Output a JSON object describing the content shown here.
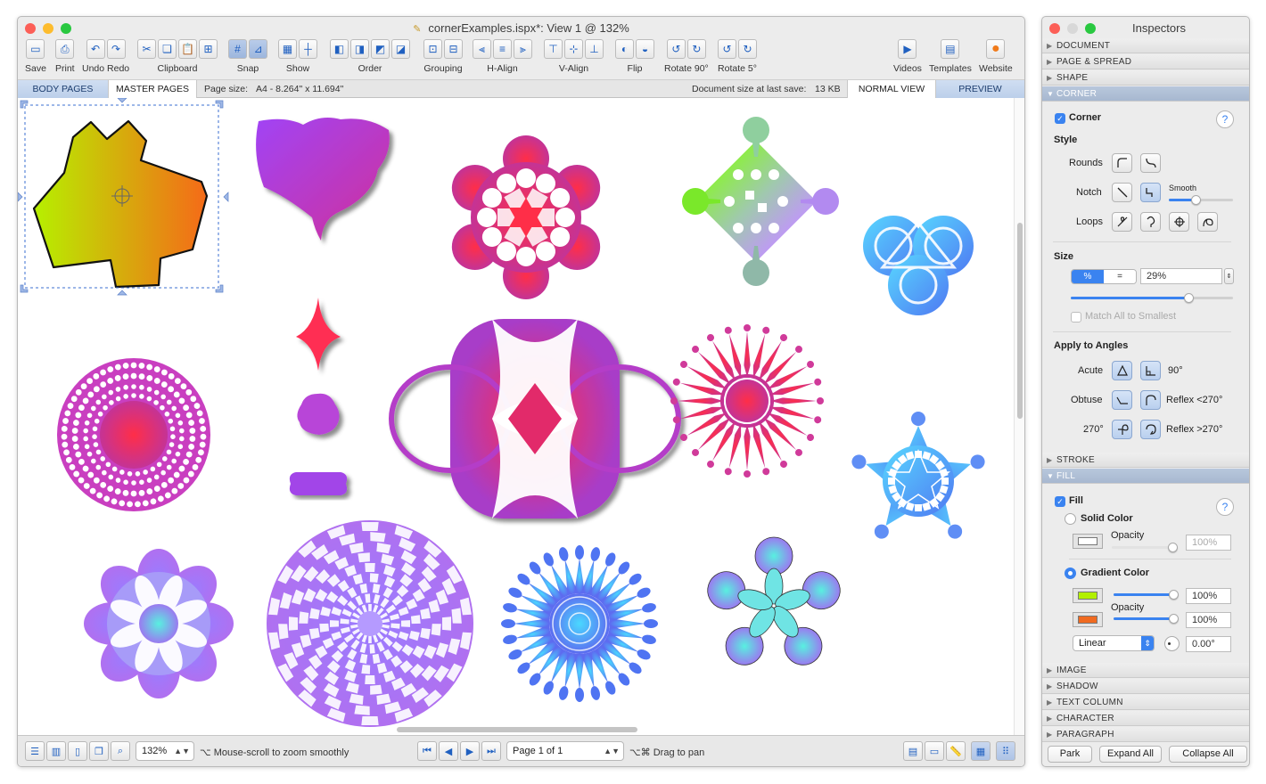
{
  "main_window": {
    "title": "cornerExamples.ispx*: View 1 @ 132%",
    "toolbar": [
      {
        "label": "Save",
        "icons": [
          "save-icon"
        ]
      },
      {
        "label": "Print",
        "icons": [
          "print-icon"
        ]
      },
      {
        "label": "Undo Redo",
        "icons": [
          "undo-icon",
          "redo-icon"
        ]
      },
      {
        "label": "Clipboard",
        "icons": [
          "cut-icon",
          "copy-icon",
          "paste-icon",
          "duplicate-icon"
        ]
      },
      {
        "label": "Snap",
        "icons": [
          "snap-grid-icon",
          "snap-object-icon"
        ]
      },
      {
        "label": "Show",
        "icons": [
          "grid-icon",
          "guides-icon"
        ]
      },
      {
        "label": "Order",
        "icons": [
          "front-icon",
          "forward-icon",
          "backward-icon",
          "back-icon"
        ]
      },
      {
        "label": "Grouping",
        "icons": [
          "group-icon",
          "ungroup-icon"
        ]
      },
      {
        "label": "H-Align",
        "icons": [
          "align-left-icon",
          "align-center-icon",
          "align-right-icon"
        ]
      },
      {
        "label": "V-Align",
        "icons": [
          "align-top-icon",
          "align-middle-icon",
          "align-bottom-icon"
        ]
      },
      {
        "label": "Flip",
        "icons": [
          "flip-h-icon",
          "flip-v-icon"
        ]
      },
      {
        "label": "Rotate 90°",
        "icons": [
          "rotate-ccw-90-icon",
          "rotate-cw-90-icon"
        ]
      },
      {
        "label": "Rotate 5°",
        "icons": [
          "rotate-ccw-5-icon",
          "rotate-cw-5-icon"
        ]
      },
      {
        "label": "Videos",
        "icons": [
          "videos-icon"
        ]
      },
      {
        "label": "Templates",
        "icons": [
          "templates-icon"
        ]
      },
      {
        "label": "Website",
        "icons": [
          "website-icon"
        ]
      }
    ],
    "pagebar": {
      "body_pages": "BODY PAGES",
      "master_pages": "MASTER PAGES",
      "page_size_label": "Page size:",
      "page_size_value": "A4 - 8.264\" x 11.694\"",
      "doc_size_label": "Document size at last save:",
      "doc_size_value": "13 KB",
      "normal_view": "NORMAL VIEW",
      "preview": "PREVIEW"
    },
    "status": {
      "zoom": "132%",
      "zoom_hint": "⌥ Mouse-scroll to zoom smoothly",
      "page": "Page 1 of 1",
      "pan_hint": "⌥⌘ Drag to pan"
    }
  },
  "inspector": {
    "title": "Inspectors",
    "sections_top": [
      "DOCUMENT",
      "PAGE & SPREAD",
      "SHAPE",
      "CORNER"
    ],
    "corner": {
      "checkbox": "Corner",
      "style_heading": "Style",
      "rounds": "Rounds",
      "notch": "Notch",
      "smooth": "Smooth",
      "loops": "Loops",
      "size_heading": "Size",
      "percent_btn": "%",
      "equal_btn": "=",
      "size_value": "29%",
      "size_fraction": 0.73,
      "match_all": "Match All to Smallest",
      "apply_heading": "Apply to Angles",
      "acute": "Acute",
      "deg90": "90°",
      "obtuse": "Obtuse",
      "reflex_lt": "Reflex <270°",
      "deg270": "270°",
      "reflex_gt": "Reflex >270°"
    },
    "sections_mid": [
      "STROKE",
      "FILL"
    ],
    "fill": {
      "checkbox": "Fill",
      "solid_color": "Solid Color",
      "opacity": "Opacity",
      "solid_opacity": "100%",
      "gradient_color": "Gradient Color",
      "grad_opacity_1": "100%",
      "grad_opacity_2": "100%",
      "gradient_type": "Linear",
      "angle": "0.00°",
      "color_1": "#b2f000",
      "color_2": "#f06a20"
    },
    "sections_bottom": [
      "IMAGE",
      "SHADOW",
      "TEXT COLUMN",
      "CHARACTER",
      "PARAGRAPH"
    ],
    "buttons": {
      "park": "Park",
      "expand_all": "Expand All",
      "collapse_all": "Collapse All"
    }
  }
}
